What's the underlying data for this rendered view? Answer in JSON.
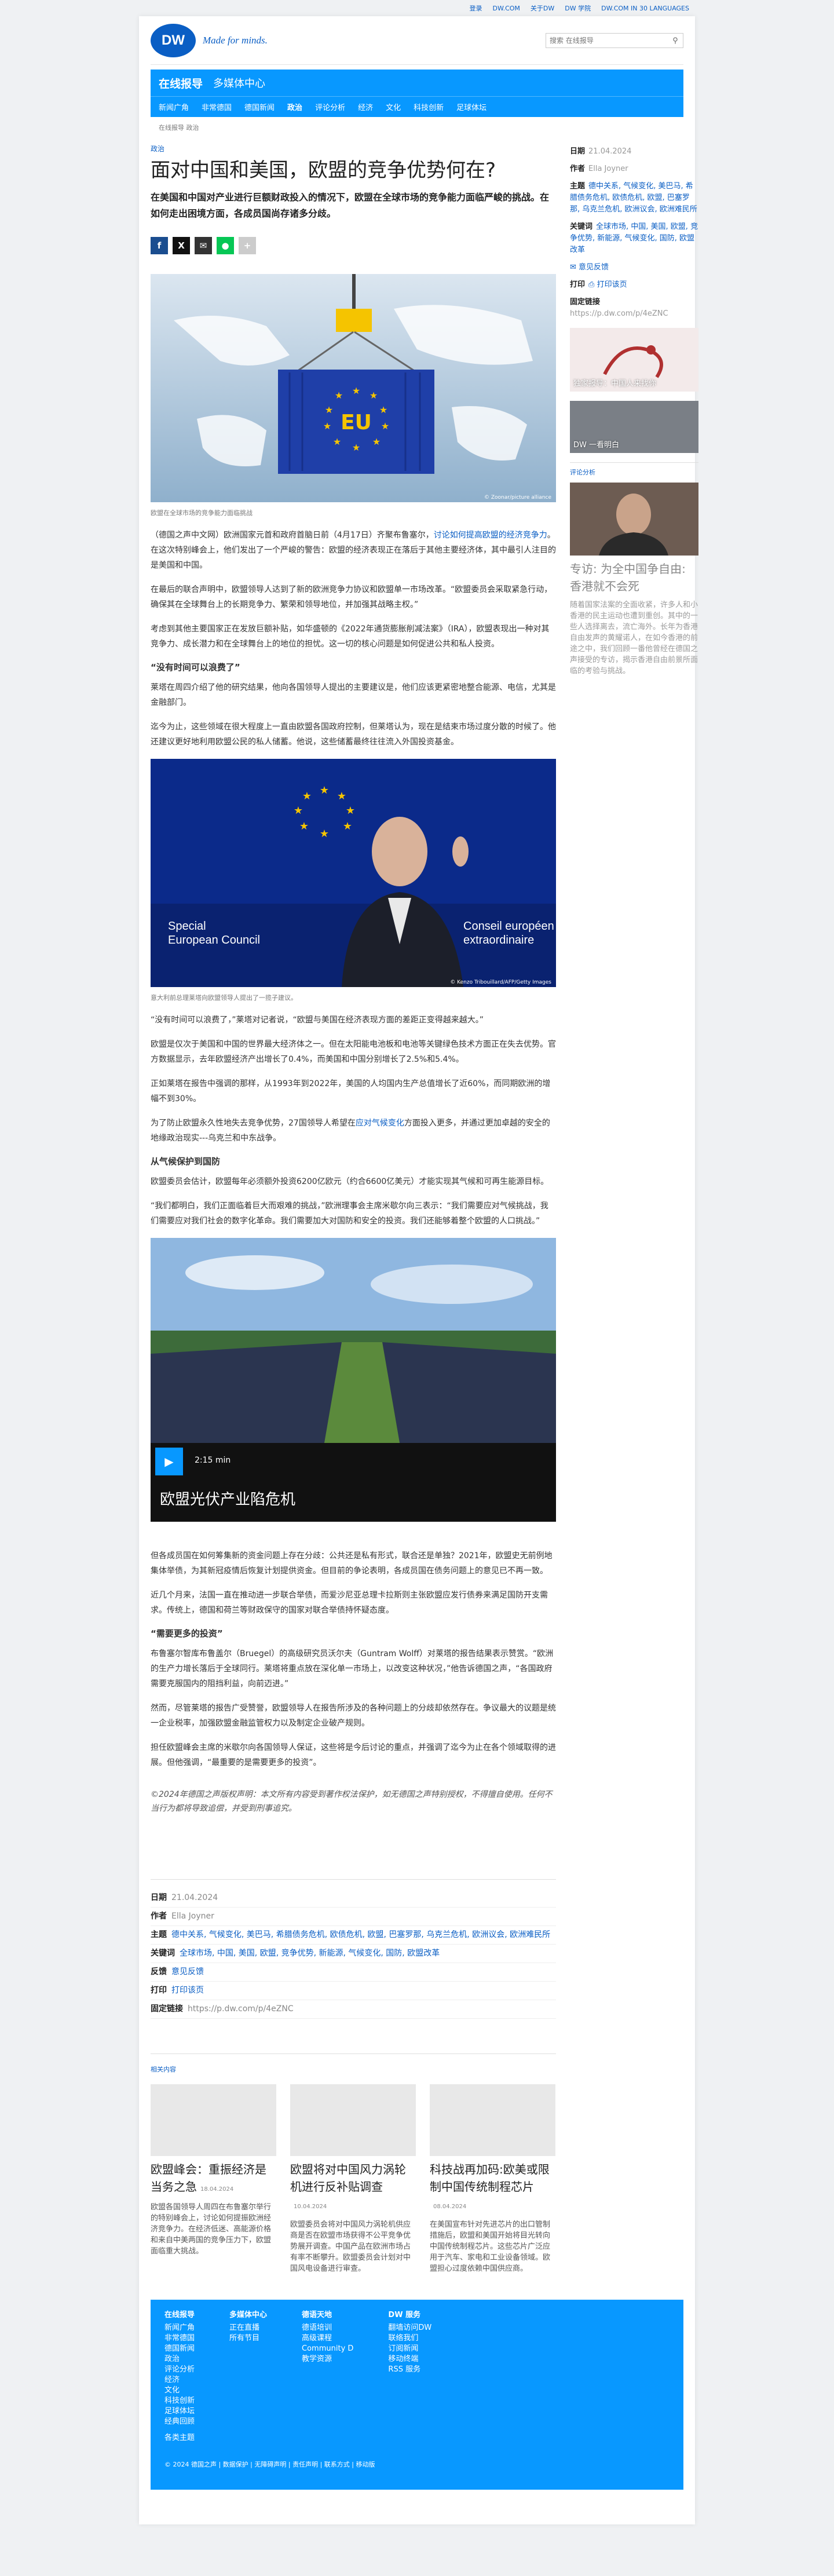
{
  "topbar": [
    "登录",
    "DW.COM",
    "关于DW",
    "DW 学院",
    "DW.COM IN 30 LANGUAGES"
  ],
  "brand": {
    "logo": "DW",
    "tagline": "Made for minds."
  },
  "search": {
    "placeholder": "搜索 在线报导"
  },
  "nav": {
    "title": "在线报导",
    "subtitle": "多媒体中心",
    "items": [
      "新闻广角",
      "非常德国",
      "德国新闻",
      "政治",
      "评论分析",
      "经济",
      "文化",
      "科技创新",
      "足球体坛"
    ]
  },
  "breadcrumb": "在线报导  政治",
  "article": {
    "kicker": "政治",
    "title": "面对中国和美国，欧盟的竞争优势何在?",
    "lead": "在美国和中国对产业进行巨额财政投入的情况下，欧盟在全球市场的竞争能力面临严峻的挑战。在如何走出困境方面，各成员国尚存诸多分歧。",
    "fig1_caption": "欧盟在全球市场的竞争能力面临挑战",
    "fig1_credit": "© Zoonar/picture alliance",
    "fig1_text": "EU",
    "p1": "（德国之声中文网）欧洲国家元首和政府首脑日前（4月17日）齐聚布鲁塞尔，",
    "p1_link": "讨论如何提高欧盟的经济竞争力",
    "p1_rest": "。在这次特别峰会上，他们发出了一个严峻的警告：欧盟的经济表现正在落后于其他主要经济体，其中最引人注目的是美国和中国。",
    "p2": "在最后的联合声明中，欧盟领导人达到了新的欧洲竞争力协议和欧盟单一市场改革。“欧盟委员会采取紧急行动，确保其在全球舞台上的长期竞争力、繁荣和领导地位，并加强其战略主权。”",
    "p3": "考虑到其他主要国家正在发放巨额补贴，如华盛顿的《2022年通货膨胀削减法案》（IRA），欧盟表现出一种对其竞争力、成长潜力和在全球舞台上的地位的担忧。这一切的核心问题是如何促进公共和私人投资。",
    "h_time": "“没有时间可以浪费了”",
    "p4": "莱塔在周四介绍了他的研究结果，他向各国领导人提出的主要建议是，他们应该更紧密地整合能源、电信，尤其是金融部门。",
    "p5": "迄今为止，这些领域在很大程度上一直由欧盟各国政府控制，但莱塔认为，现在是结束市场过度分散的时候了。他还建议更好地利用欧盟公民的私人储蓄。他说，这些储蓄最终往往流入外国投资基金。",
    "fig2_caption": "意大利前总理莱塔向欧盟领导人提出了一揽子建议。",
    "fig2_credit": "© Kenzo Tribouillard/AFP/Getty Images",
    "fig2_sign_left": "Special\nEuropean Council",
    "fig2_sign_right": "Conseil européen\nextraordinaire",
    "p6": "“没有时间可以浪费了，”莱塔对记者说，“欧盟与美国在经济表现方面的差距正变得越来越大。”",
    "p7": "欧盟是仅次于美国和中国的世界最大经济体之一。但在太阳能电池板和电池等关键绿色技术方面正在失去优势。官方数据显示，去年欧盟经济产出增长了0.4%，而美国和中国分别增长了2.5%和5.4%。",
    "p8": "正如莱塔在报告中强调的那样，从1993年到2022年，美国的人均国内生产总值增长了近60%，而同期欧洲的增幅不到30%。",
    "p9a": "为了防止欧盟永久性地失去竞争优势，27国领导人希望在",
    "p9_link": "应对气候变化",
    "p9b": "方面投入更多，并通过更加卓越的安全的地缘政治现实---乌克兰和中东战争。",
    "h_climate": "从气候保护到国防",
    "p10": "欧盟委员会估计，欧盟每年必须额外投资6200亿欧元（约合6600亿美元）才能实现其气候和可再生能源目标。",
    "p11": "“我们都明白，我们正面临着巨大而艰难的挑战，”欧洲理事会主席米歇尔向三表示：“我们需要应对气候挑战，我们需要应对我们社会的数字化革命。我们需要加大对国防和安全的投资。我们还能够着整个欧盟的人口挑战。”",
    "video_duration": "2:15 min",
    "video_title": "欧盟光伏产业陷危机",
    "p12": "但各成员国在如何筹集新的资金问题上存在分歧：公共还是私有形式，联合还是单独？2021年，欧盟史无前例地集体举债，为其新冠疫情后恢复计划提供资金。但目前的争论表明，各成员国在债务问题上的意见已不再一致。",
    "p13": "近几个月来，法国一直在推动进一步联合举债，而爱沙尼亚总理卡拉斯则主张欧盟应发行债券来满足国防开支需求。传统上，德国和荷兰等财政保守的国家对联合举债持怀疑态度。",
    "h_invest": "“需要更多的投资”",
    "p14": "布鲁塞尔智库布鲁盖尔（Bruegel）的高级研究员沃尔夫（Guntram Wolff）对莱塔的报告结果表示赞赏。“欧洲的生产力增长落后于全球同行。莱塔将重点放在深化单一市场上，以改变这种状况，”他告诉德国之声，“各国政府需要克服国内的阻挡利益，向前迈进。”",
    "p15": "然而，尽管莱塔的报告广受赞誉，欧盟领导人在报告所涉及的各种问题上的分歧却依然存在。争议最大的议题是统一企业税率，加强欧盟金融监管权力以及制定企业破产规则。",
    "p16": "担任欧盟峰会主席的米歇尔向各国领导人保证，这些将是今后讨论的重点，并强调了迄今为止在各个领域取得的进展。但他强调，“最重要的是需要更多的投资”。",
    "copyright": "©2024年德国之声版权声明：本文所有内容受到著作权法保护，如无德国之声特别授权，不得擅自使用。任何不当行为都将导致追偿，并受到刑事追究。"
  },
  "meta": {
    "date_label": "日期",
    "date": "21.04.2024",
    "author_label": "作者",
    "author": "Ella Joyner",
    "topics_label": "主题",
    "topics": "德中关系, 气候变化, 美巴马, 希腊债务危机, 欧债危机, 欧盟, 巴塞罗那, 乌克兰危机, 欧洲议会, 欧洲难民所",
    "keywords_label": "关键词",
    "keywords": "全球市场, 中国, 美国, 欧盟, 竞争优势, 新能源, 气候变化, 国防, 欧盟改革",
    "feedback_label": "反馈",
    "feedback": "意见反馈",
    "print_label": "打印",
    "print": "打印该页",
    "link_label": "固定链接",
    "link": "https://p.dw.com/p/4eZNC"
  },
  "sidebar": {
    "date_label": "日期",
    "date": "21.04.2024",
    "author_label": "作者",
    "author": "Ella Joyner",
    "topics_label": "主题",
    "topics": "德中关系, 气候变化, 美巴马, 希腊债务危机, 欧债危机, 欧盟, 巴塞罗那, 乌克兰危机, 欧洲议会, 欧洲难民所",
    "keywords_label": "关键词",
    "keywords": "全球市场, 中国, 美国, 欧盟, 竞争优势, 新能源, 气候变化, 国防, 欧盟改革",
    "feedback": "意见反馈",
    "print_label": "打印",
    "print": "打印该页",
    "link_label": "固定链接",
    "link": "https://p.dw.com/p/4eZNC",
    "widget1": "独家报导：中国人来找你",
    "widget2": "DW 一看明白",
    "section": "评论分析",
    "story_title": "专访: 为全中国争自由: 香港就不会死",
    "story_text": "随着国家法案的全面收紧，许多人和小香港的民主运动也遭到重创。其中的一些人选择离去，流亡海外。长年为香港自由发声的黄耀诺人，在如今香港的前途之中，我们回顾一番他曾经在德国之声接受的专访，揭示香港自由前景所面临的考验与挑战。"
  },
  "related": {
    "heading": "相关内容",
    "items": [
      {
        "title": "欧盟峰会：重振经济是当务之急",
        "date": "18.04.2024",
        "text": "欧盟各国领导人周四在布鲁塞尔举行的特别峰会上，讨论如何提振欧洲经济竞争力。在经济低迷、高能源价格和来自中美两国的竞争压力下，欧盟面临重大挑战。"
      },
      {
        "title": "欧盟将对中国风力涡轮机进行反补贴调查",
        "date": "10.04.2024",
        "text": "欧盟委员会将对中国风力涡轮机供应商是否在欧盟市场获得不公平竞争优势展开调查。中国产品在欧洲市场占有率不断攀升。欧盟委员会计划对中国风电设备进行审查。"
      },
      {
        "title": "科技战再加码:欧美或限制中国传统制程芯片",
        "date": "08.04.2024",
        "text": "在美国宣布针对先进芯片的出口管制措施后，欧盟和美国开始将目光转向中国传统制程芯片。这些芯片广泛应用于汽车、家电和工业设备领域。欧盟担心过度依赖中国供应商。"
      }
    ]
  },
  "footer": {
    "cols": [
      {
        "title": "在线报导",
        "items": [
          "新闻广角",
          "非常德国",
          "德国新闻",
          "政治",
          "评论分析",
          "经济",
          "文化",
          "科技创新",
          "足球体坛",
          "经典回顾"
        ]
      },
      {
        "title": "多媒体中心",
        "items": [
          "正在直播",
          "所有节目"
        ]
      },
      {
        "title": "德语天地",
        "items": [
          "德语培训",
          "高级课程",
          "Community D",
          "教学资源"
        ]
      },
      {
        "title": "DW 服务",
        "items": [
          "翻墙访问DW",
          "联络我们",
          "订阅新闻",
          "移动终端",
          "RSS 服务"
        ]
      }
    ],
    "sub": "各类主题",
    "bottom": "© 2024 德国之声 | 数据保护 | 无障碍声明 | 责任声明 | 联系方式 | 移动版"
  },
  "colors": {
    "brand": "#0898ff",
    "link": "#0a5ec4"
  }
}
